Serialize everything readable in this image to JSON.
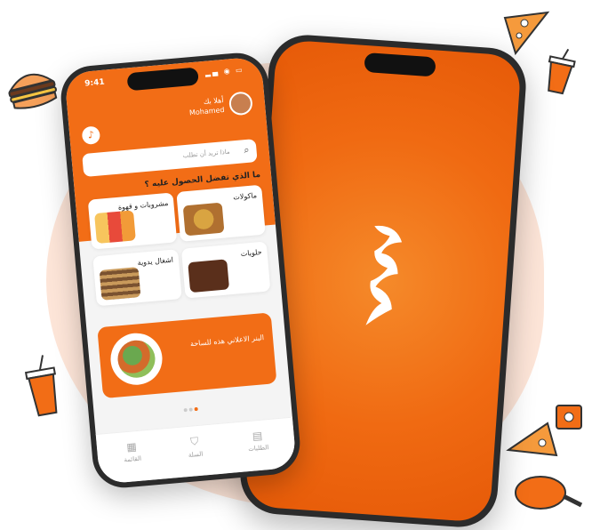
{
  "app": {
    "status_time": "9:41",
    "greeting": "أهلا بك",
    "user_name": "Mohamed",
    "search_placeholder": "ماذا تريد أن تطلب",
    "question": "ما الذي تفضل الحصول عليه ؟",
    "categories": [
      {
        "label": "ماكولات"
      },
      {
        "label": "مشروبات و قهوة"
      },
      {
        "label": "حلويات"
      },
      {
        "label": "اشغال يدوية"
      }
    ],
    "banner_text": "البنر الاعلاني هذه للساحة",
    "nav": [
      {
        "label": "القائمة",
        "icon": "grid-icon"
      },
      {
        "label": "السلة",
        "icon": "bag-icon"
      },
      {
        "label": "الطلبات",
        "icon": "orders-icon"
      }
    ]
  },
  "colors": {
    "accent": "#f26d16",
    "background_blob": "#fde5d8"
  },
  "decorations": [
    "burger-icon",
    "pizza-icon",
    "drink-cup-icon",
    "chicken-leg-icon"
  ]
}
